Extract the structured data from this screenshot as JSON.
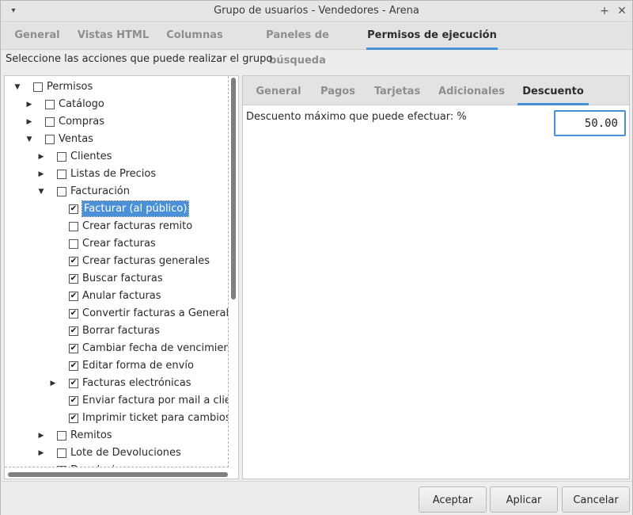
{
  "window": {
    "title": "Grupo de usuarios - Vendedores - Arena",
    "menu_glyph": "▾",
    "maximize_glyph": "+",
    "close_glyph": "✕"
  },
  "tabs": [
    {
      "label": "General",
      "active": false
    },
    {
      "label": "Vistas HTML",
      "active": false
    },
    {
      "label": "Columnas",
      "active": false
    },
    {
      "label": "Paneles de búsqueda",
      "active": false
    },
    {
      "label": "Permisos de ejecución",
      "active": true
    }
  ],
  "instruction": "Seleccione las acciones que puede realizar el grupo",
  "tree": {
    "items": [
      {
        "label": "Permisos",
        "expander": "expanded",
        "checked": false
      },
      {
        "label": "Catálogo",
        "expander": "collapsed",
        "checked": false
      },
      {
        "label": "Compras",
        "expander": "collapsed",
        "checked": false
      },
      {
        "label": "Ventas",
        "expander": "expanded",
        "checked": false
      },
      {
        "label": "Clientes",
        "expander": "collapsed",
        "checked": false
      },
      {
        "label": "Listas de Precios",
        "expander": "collapsed",
        "checked": false
      },
      {
        "label": "Facturación",
        "expander": "expanded",
        "checked": false
      },
      {
        "label": "Facturar (al público)",
        "expander": "none",
        "checked": true,
        "selected": true
      },
      {
        "label": "Crear facturas remito",
        "expander": "none",
        "checked": false
      },
      {
        "label": "Crear facturas",
        "expander": "none",
        "checked": false
      },
      {
        "label": "Crear facturas generales",
        "expander": "none",
        "checked": true
      },
      {
        "label": "Buscar facturas",
        "expander": "none",
        "checked": true
      },
      {
        "label": "Anular facturas",
        "expander": "none",
        "checked": true
      },
      {
        "label": "Convertir facturas a General",
        "expander": "none",
        "checked": true
      },
      {
        "label": "Borrar facturas",
        "expander": "none",
        "checked": true
      },
      {
        "label": "Cambiar fecha de vencimiento de",
        "expander": "none",
        "checked": true
      },
      {
        "label": "Editar forma de envío",
        "expander": "none",
        "checked": true
      },
      {
        "label": "Facturas electrónicas",
        "expander": "collapsed",
        "checked": true
      },
      {
        "label": "Enviar factura por mail a cliente",
        "expander": "none",
        "checked": true
      },
      {
        "label": "Imprimir ticket para cambios (re",
        "expander": "none",
        "checked": true
      },
      {
        "label": "Remitos",
        "expander": "collapsed",
        "checked": false
      },
      {
        "label": "Lote de Devoluciones",
        "expander": "collapsed",
        "checked": false
      },
      {
        "label": "Devoluciones",
        "expander": "collapsed",
        "checked": false
      }
    ]
  },
  "inner_tabs": [
    {
      "label": "General",
      "active": false
    },
    {
      "label": "Pagos",
      "active": false
    },
    {
      "label": "Tarjetas",
      "active": false
    },
    {
      "label": "Adicionales",
      "active": false
    },
    {
      "label": "Descuento",
      "active": true
    }
  ],
  "discount": {
    "label": "Descuento máximo que puede efectuar: %",
    "value": "50.00"
  },
  "buttons": {
    "accept": "Aceptar",
    "apply": "Aplicar",
    "cancel": "Cancelar"
  }
}
